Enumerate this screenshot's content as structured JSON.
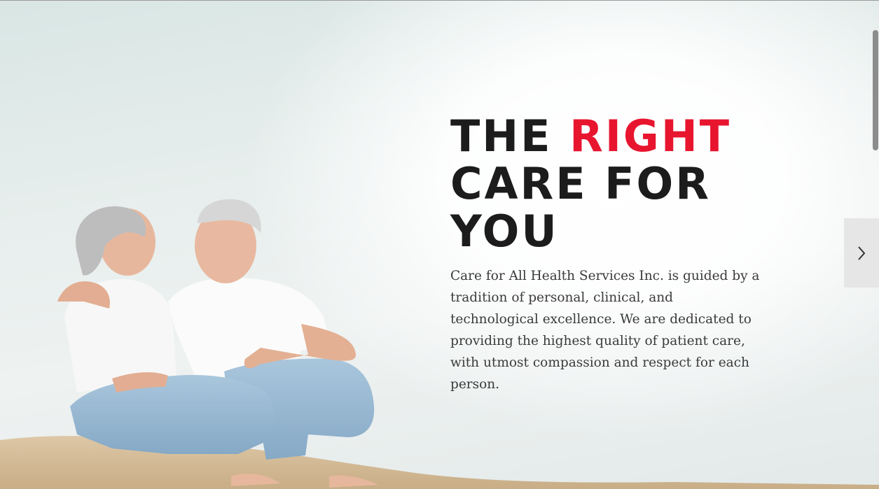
{
  "hero": {
    "headline": {
      "line1_start": "THE ",
      "line1_accent": "RIGHT",
      "line2": "CARE FOR",
      "line3": "YOU"
    },
    "description": "Care for All Health Services Inc. is guided by a tradition of personal, clinical, and technological excellence. We are dedicated to providing the highest quality of patient care, with utmost compassion and respect for each person.",
    "image": "photo-elderly-couple-sitting-on-sand",
    "next_icon": "chevron-right-icon"
  },
  "colors": {
    "headline": "#1c1c1c",
    "accent": "#e8152f",
    "body_text": "#3a3a3a",
    "arrow_bg": "#e6e6e6"
  }
}
